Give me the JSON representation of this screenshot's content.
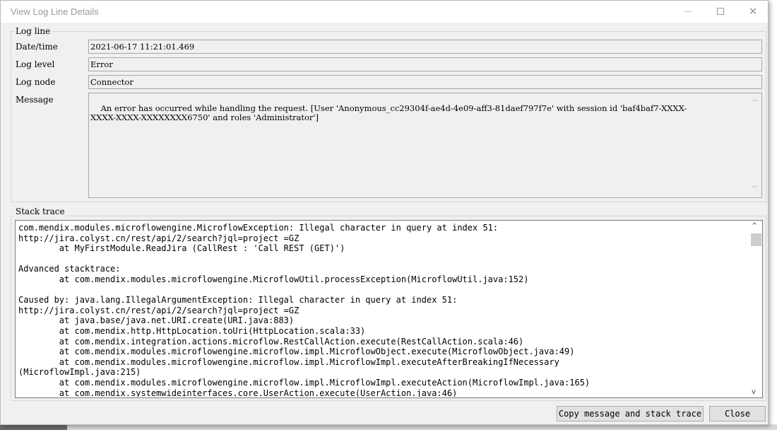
{
  "window": {
    "title": "View Log Line Details"
  },
  "log_line": {
    "group_label": "Log line",
    "fields": {
      "datetime": {
        "label": "Date/time",
        "value": "2021-06-17 11:21:01.469"
      },
      "level": {
        "label": "Log level",
        "value": "Error"
      },
      "node": {
        "label": "Log node",
        "value": "Connector"
      },
      "message": {
        "label": "Message",
        "value": "An error has occurred while handling the request. [User 'Anonymous_cc29304f-ae4d-4e09-aff3-81daef797f7e' with session id 'baf4baf7-XXXX-\nXXXX-XXXX-XXXXXXXX6750' and roles 'Administrator']"
      }
    }
  },
  "stack_trace": {
    "group_label": "Stack trace",
    "text": "com.mendix.modules.microflowengine.MicroflowException: Illegal character in query at index 51:\nhttp://jira.colyst.cn/rest/api/2/search?jql=project =GZ\n\tat MyFirstModule.ReadJira (CallRest : 'Call REST (GET)')\n\nAdvanced stacktrace:\n\tat com.mendix.modules.microflowengine.MicroflowUtil.processException(MicroflowUtil.java:152)\n\nCaused by: java.lang.IllegalArgumentException: Illegal character in query at index 51:\nhttp://jira.colyst.cn/rest/api/2/search?jql=project =GZ\n\tat java.base/java.net.URI.create(URI.java:883)\n\tat com.mendix.http.HttpLocation.toUri(HttpLocation.scala:33)\n\tat com.mendix.integration.actions.microflow.RestCallAction.execute(RestCallAction.scala:46)\n\tat com.mendix.modules.microflowengine.microflow.impl.MicroflowObject.execute(MicroflowObject.java:49)\n\tat com.mendix.modules.microflowengine.microflow.impl.MicroflowImpl.executeAfterBreakingIfNecessary\n(MicroflowImpl.java:215)\n\tat com.mendix.modules.microflowengine.microflow.impl.MicroflowImpl.executeAction(MicroflowImpl.java:165)\n\tat com.mendix.systemwideinterfaces.core.UserAction.execute(UserAction.java:46)"
  },
  "buttons": {
    "copy": "Copy message and stack trace",
    "close": "Close"
  },
  "icons": {
    "minimize": "minimize-icon",
    "maximize": "maximize-icon",
    "close": "close-icon",
    "scroll_up": "chevron-up-icon",
    "scroll_down": "chevron-down-icon"
  },
  "colors": {
    "dialog_bg": "#f0f0f0",
    "title_text": "#9a9a9a",
    "button_bg": "#e1e1e1"
  }
}
